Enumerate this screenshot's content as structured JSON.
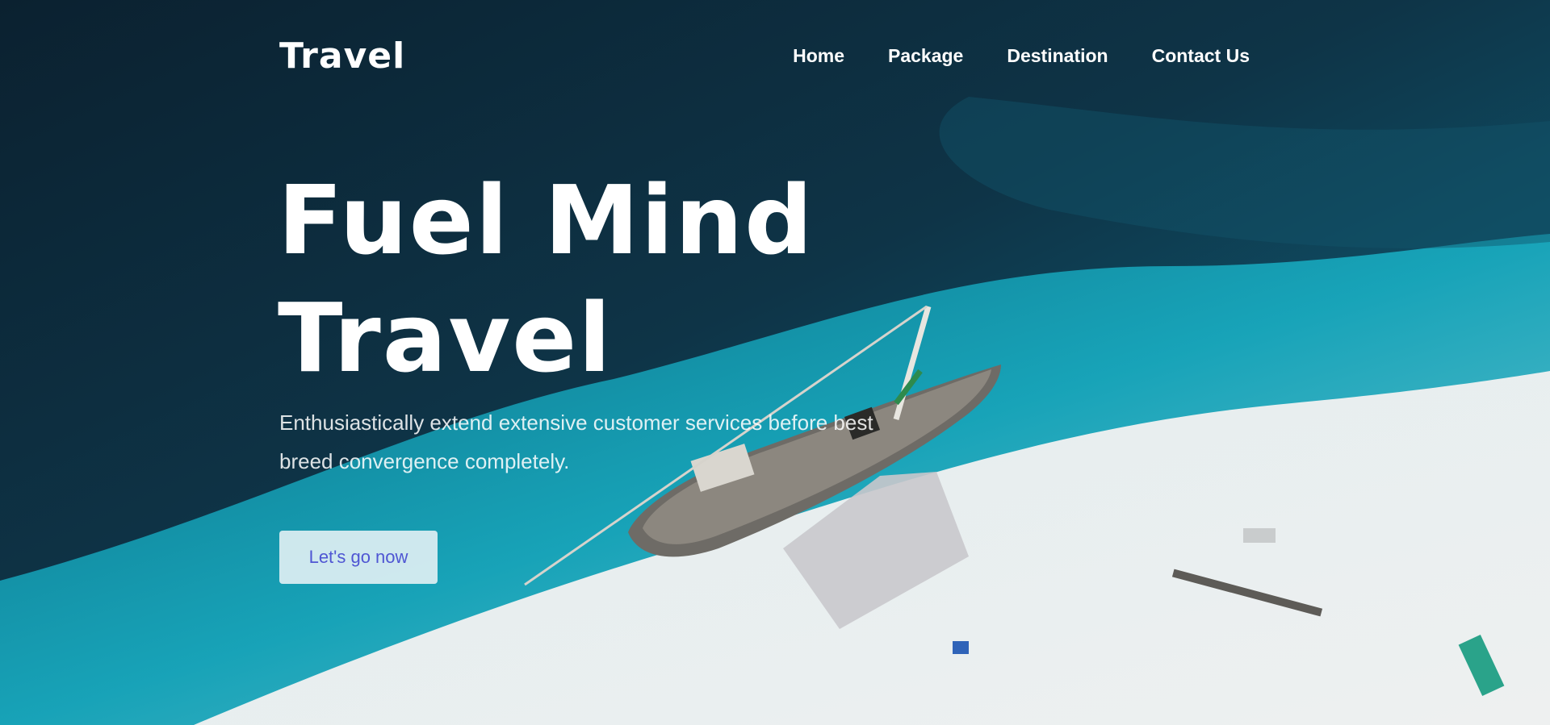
{
  "header": {
    "logo": "Travel",
    "nav": [
      "Home",
      "Package",
      "Destination",
      "Contact Us"
    ]
  },
  "hero": {
    "title_line1": "Fuel Mind",
    "title_line2": "Travel",
    "description": "Enthusiastically extend extensive customer services before best breed convergence completely.",
    "cta_label": "Let's go now"
  },
  "colors": {
    "text": "#ffffff",
    "cta_text": "#4f56d3",
    "cta_background": "#e8f3f6",
    "deep_water": "#0d3446",
    "shallow_water": "#12a7bd",
    "sand": "#e9edee"
  },
  "icons": [
    "boat-image"
  ]
}
